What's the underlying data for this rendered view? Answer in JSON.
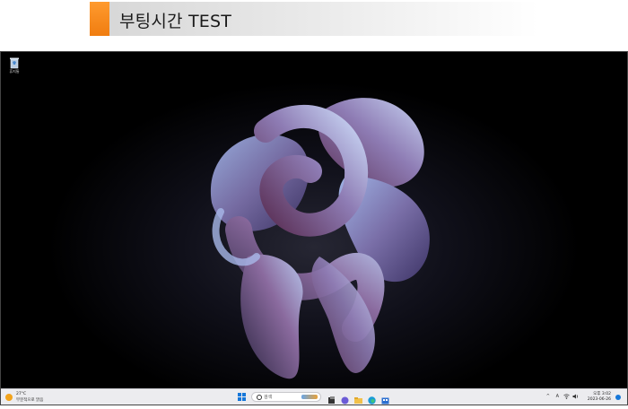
{
  "header": {
    "title": "부팅시간 TEST",
    "accent_color": "#f58a1f"
  },
  "desktop": {
    "icons": [
      {
        "label": "휴지통",
        "icon": "recycle-bin-icon"
      }
    ]
  },
  "taskbar": {
    "weather": {
      "temp": "27°C",
      "condition": "부분적으로 맑음",
      "icon": "sun-icon"
    },
    "search_placeholder": "검색",
    "apps": [
      "start-icon",
      "file-explorer-icon",
      "chat-icon",
      "folder-icon",
      "edge-icon",
      "store-icon"
    ],
    "tray": {
      "chevron": "^",
      "lang": "A",
      "time": "오후 3:02",
      "date": "2023-06-26"
    }
  }
}
